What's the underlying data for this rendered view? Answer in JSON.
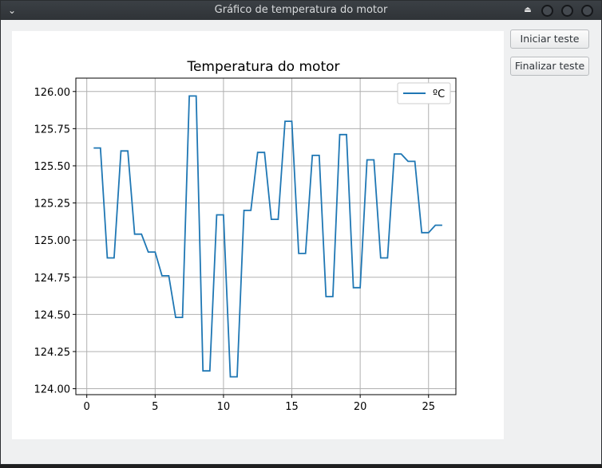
{
  "window": {
    "title": "Gráfico de temperatura do motor",
    "menu_icon": "chevron-down-icon",
    "buttons": [
      "eject-icon",
      "minimize-icon",
      "maximize-icon",
      "close-icon"
    ]
  },
  "controls": {
    "start_label": "Iniciar teste",
    "stop_label": "Finalizar teste"
  },
  "colors": {
    "line": "#1f77b4",
    "titlebar": "#34383c",
    "window_bg": "#eff0f1"
  },
  "chart_data": {
    "type": "line",
    "title": "Temperatura do motor",
    "xlabel": "",
    "ylabel": "",
    "xlim": [
      -0.8,
      27.0
    ],
    "ylim": [
      123.96,
      126.09
    ],
    "xticks": [
      0,
      5,
      10,
      15,
      20,
      25
    ],
    "yticks": [
      "124.00",
      "124.25",
      "124.50",
      "124.75",
      "125.00",
      "125.25",
      "125.50",
      "125.75",
      "126.00"
    ],
    "grid": true,
    "legend_position": "upper right",
    "series": [
      {
        "name": "ºC",
        "x": [
          0.5,
          1.0,
          1.5,
          2.0,
          2.5,
          3.0,
          3.5,
          4.0,
          4.5,
          5.0,
          5.5,
          6.0,
          6.5,
          7.0,
          7.5,
          8.0,
          8.5,
          9.0,
          9.5,
          10.0,
          10.5,
          11.0,
          11.5,
          12.0,
          12.5,
          13.0,
          13.5,
          14.0,
          14.5,
          15.0,
          15.5,
          16.0,
          16.5,
          17.0,
          17.5,
          18.0,
          18.5,
          19.0,
          19.5,
          20.0,
          20.5,
          21.0,
          21.5,
          22.0,
          22.5,
          23.0,
          23.5,
          24.0,
          24.5,
          25.0,
          25.5,
          26.0
        ],
        "y": [
          125.62,
          125.62,
          124.88,
          124.88,
          125.6,
          125.6,
          125.04,
          125.04,
          124.92,
          124.92,
          124.76,
          124.76,
          124.48,
          124.48,
          125.97,
          125.97,
          124.12,
          124.12,
          125.17,
          125.17,
          124.08,
          124.08,
          125.2,
          125.2,
          125.59,
          125.59,
          125.14,
          125.14,
          125.8,
          125.8,
          124.91,
          124.91,
          125.57,
          125.57,
          124.62,
          124.62,
          125.71,
          125.71,
          124.68,
          124.68,
          125.54,
          125.54,
          124.88,
          124.88,
          125.58,
          125.58,
          125.53,
          125.53,
          125.05,
          125.05,
          125.1,
          125.1
        ]
      }
    ]
  }
}
